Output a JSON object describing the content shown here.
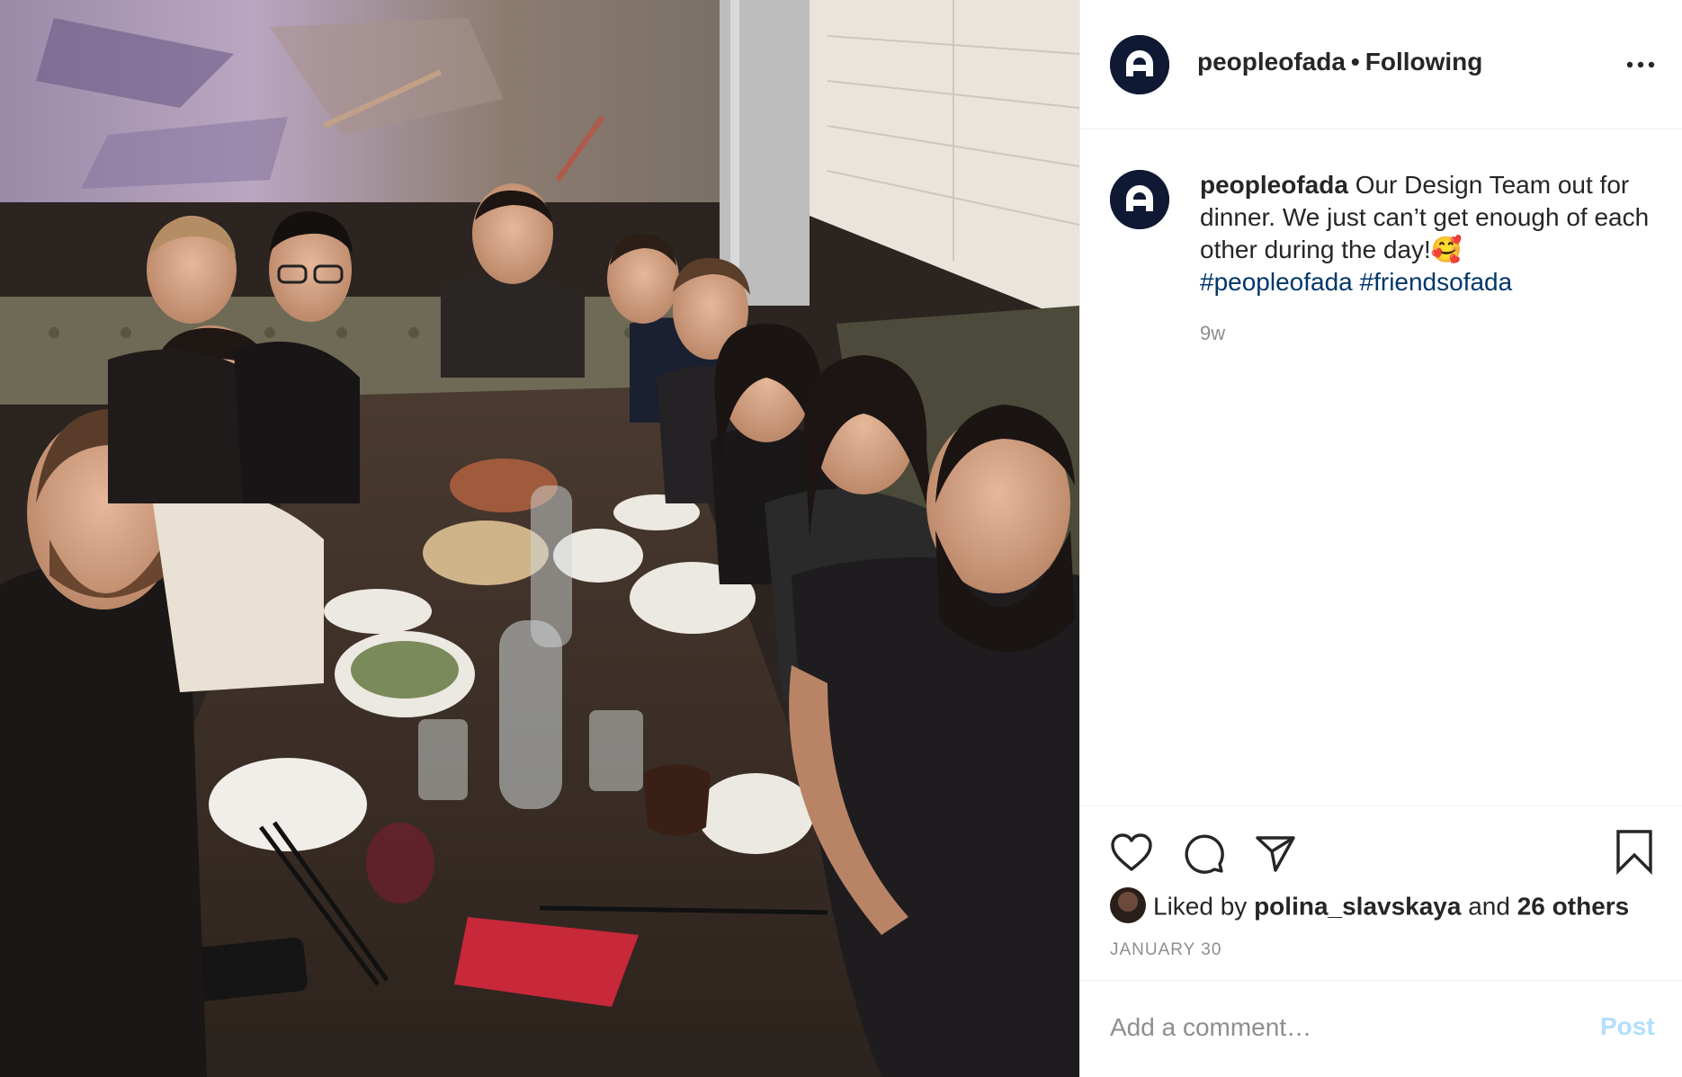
{
  "post": {
    "username": "peopleofada",
    "follow_status": "Following",
    "separator": "•",
    "caption": {
      "username": "peopleofada",
      "text": "Our Design Team out for dinner. We just can’t get enough of each other during the day!🥰",
      "hashtags": [
        "#peopleofada",
        "#friendsofada"
      ]
    },
    "age": "9w",
    "likes": {
      "prefix": "Liked by",
      "user": "polina_slavskaya",
      "middle": "and",
      "others": "26 others"
    },
    "date": "JANUARY 30",
    "comment": {
      "placeholder": "Add a comment…",
      "post_label": "Post"
    }
  },
  "icons": {
    "more": "more-options-icon",
    "like": "heart-icon",
    "comment": "comment-icon",
    "share": "share-icon",
    "save": "bookmark-icon"
  },
  "colors": {
    "avatar_bg": "#0f1933",
    "hashtag": "#00376b",
    "secondary_text": "#8e8e8e",
    "post_button": "#b2dffc"
  }
}
